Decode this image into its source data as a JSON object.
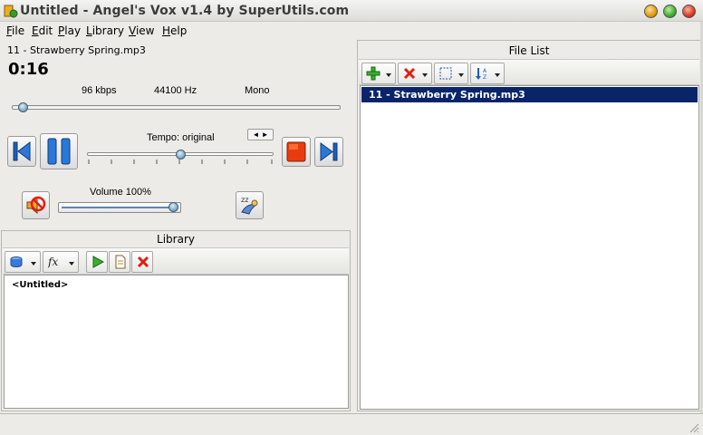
{
  "window": {
    "title": "Untitled - Angel's Vox v1.4 by SuperUtils.com"
  },
  "menu": [
    {
      "key": "F",
      "rest": "ile"
    },
    {
      "key": "E",
      "rest": "dit"
    },
    {
      "key": "P",
      "rest": "lay"
    },
    {
      "key": "L",
      "rest": "ibrary"
    },
    {
      "key": "V",
      "rest": "iew"
    },
    {
      "key": "H",
      "rest": "elp"
    }
  ],
  "player": {
    "track_name": "11 - Strawberry Spring.mp3",
    "time": "0:16",
    "bitrate": "96 kbps",
    "sample_rate": "44100 Hz",
    "channels": "Mono",
    "position_fraction": 0.02,
    "tempo_label": "Tempo: original",
    "tempo_fraction": 0.5,
    "volume_label": "Volume 100%",
    "volume_percent": 100
  },
  "library": {
    "header": "Library",
    "items": [
      "<Untitled>"
    ]
  },
  "file_list": {
    "header": "File List",
    "items": [
      "11 - Strawberry Spring.mp3"
    ]
  },
  "colors": {
    "selection": "#0a246a",
    "accent_blue": "#1c5fb8",
    "stop_red": "#e83c10"
  }
}
